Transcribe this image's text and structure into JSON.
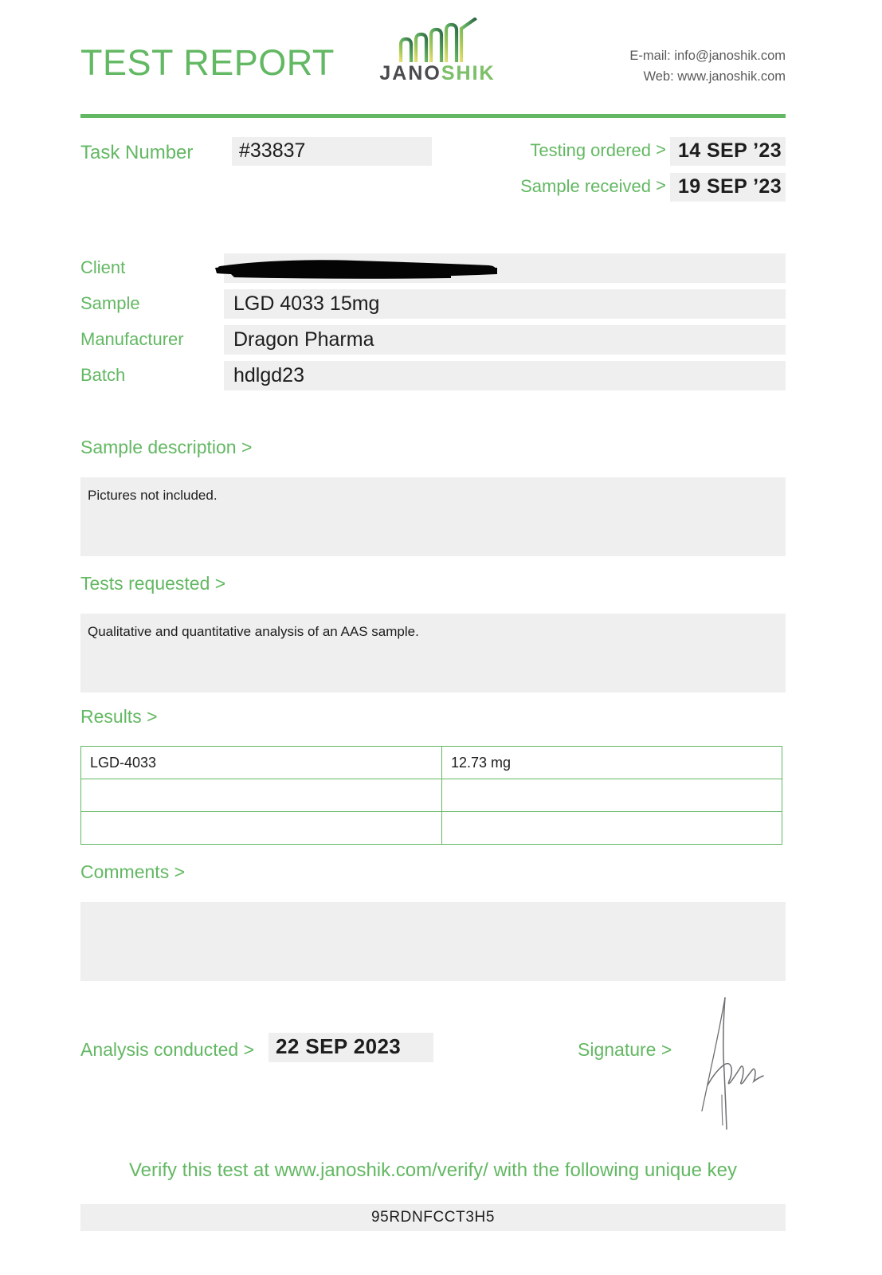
{
  "header": {
    "title": "TEST REPORT",
    "logo": {
      "mark_name": "janoshik-chart-mark",
      "word_first": "JANO",
      "word_second": "SHIK"
    },
    "contact": {
      "email_line": "E-mail: info@janoshik.com",
      "web_line": "Web: www.janoshik.com"
    }
  },
  "task": {
    "label": "Task Number",
    "value": "#33837",
    "testing_ordered_label": "Testing ordered",
    "testing_ordered_value": "14 SEP ’23",
    "sample_received_label": "Sample received",
    "sample_received_value": "19 SEP ’23",
    "caret": ">"
  },
  "info": {
    "client_label": "Client",
    "client_value": "",
    "sample_label": "Sample",
    "sample_value": "LGD 4033 15mg",
    "manufacturer_label": "Manufacturer",
    "manufacturer_value": "Dragon Pharma",
    "batch_label": "Batch",
    "batch_value": "hdlgd23"
  },
  "sample_description": {
    "heading": "Sample description >",
    "text": "Pictures not included."
  },
  "tests_requested": {
    "heading": "Tests requested >",
    "text": "Qualitative and quantitative analysis of an AAS sample."
  },
  "results": {
    "heading": "Results >",
    "rows": [
      {
        "name": "LGD-4033",
        "amount": "12.73 mg"
      },
      {
        "name": "",
        "amount": ""
      },
      {
        "name": "",
        "amount": ""
      }
    ]
  },
  "comments": {
    "heading": "Comments >",
    "text": ""
  },
  "footer": {
    "analysis_label": "Analysis conducted >",
    "analysis_value": "22 SEP 2023",
    "signature_label": "Signature >",
    "signature_name": "handwritten-signature",
    "verify_text": "Verify this test at www.janoshik.com/verify/ with the following unique key",
    "unique_key": "95RDNFCCT3H5"
  },
  "colors": {
    "brand_green": "#63b863",
    "field_gray": "#efefef",
    "text_dark": "#1d1d1d",
    "logo_dark": "#4b4b4f"
  }
}
